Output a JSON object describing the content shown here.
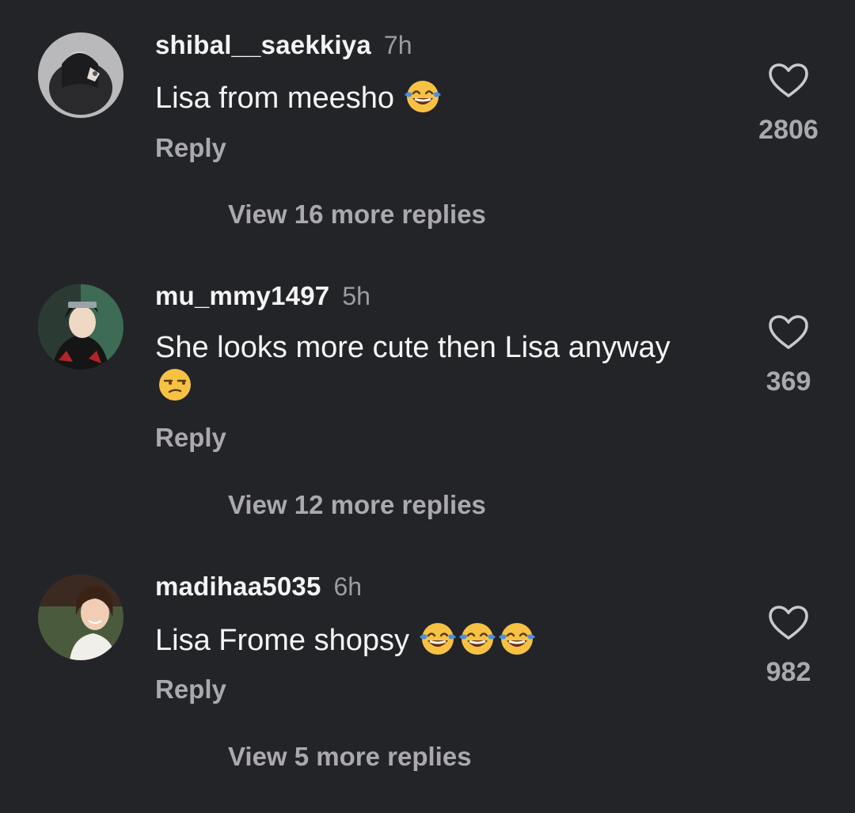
{
  "comments": [
    {
      "username": "shibal__saekkiya",
      "time": "7h",
      "text": "Lisa from meesho",
      "emojis": [
        "laughing-tears"
      ],
      "reply_label": "Reply",
      "view_replies": "View 16 more replies",
      "likes": "2806"
    },
    {
      "username": "mu_mmy1497",
      "time": "5h",
      "text": "She looks more cute then Lisa anyway",
      "emojis": [
        "unamused"
      ],
      "reply_label": "Reply",
      "view_replies": "View 12 more replies",
      "likes": "369"
    },
    {
      "username": "madihaa5035",
      "time": "6h",
      "text": "Lisa Frome shopsy",
      "emojis": [
        "laughing-tears",
        "laughing-tears",
        "laughing-tears"
      ],
      "reply_label": "Reply",
      "view_replies": "View 5 more replies",
      "likes": "982"
    }
  ],
  "colors": {
    "background": "#232428",
    "primary_text": "#f4f4f4",
    "secondary_text": "#a9a9ae",
    "emoji_yellow": "#f7c243",
    "emoji_tears": "#4a8fe0"
  },
  "icons": {
    "like": "heart-outline-icon",
    "laughing": "face-with-tears-of-joy-icon",
    "unamused": "unamused-face-icon"
  }
}
